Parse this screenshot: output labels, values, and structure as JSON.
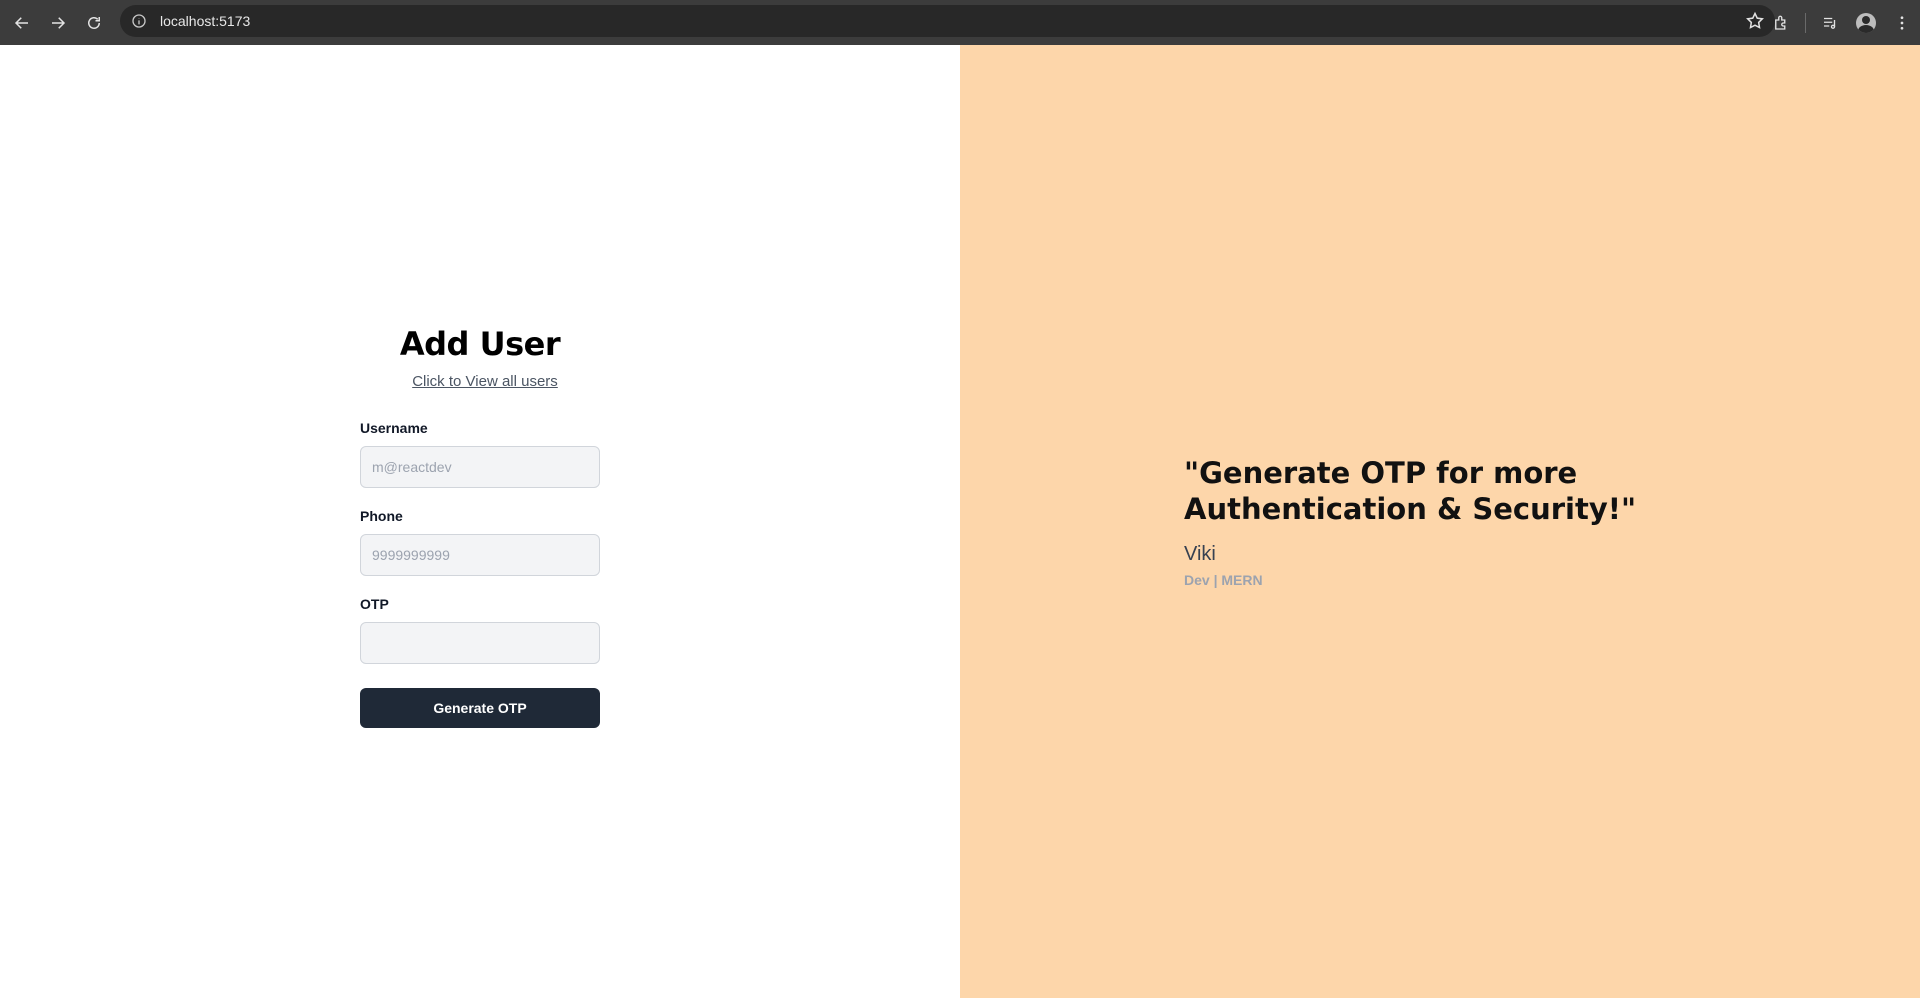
{
  "browser": {
    "url": "localhost:5173"
  },
  "form": {
    "title": "Add User",
    "view_link": "Click to View all users",
    "username_label": "Username",
    "username_placeholder": "m@reactdev",
    "phone_label": "Phone",
    "phone_placeholder": "9999999999",
    "otp_label": "OTP",
    "otp_value": "",
    "submit_label": "Generate OTP"
  },
  "quote": {
    "text": "\"Generate OTP for more Authentication & Security!\"",
    "author": "Viki",
    "role": "Dev | MERN"
  },
  "colors": {
    "right_pane_bg": "#fdd6aa",
    "button_bg": "#1f2937"
  }
}
